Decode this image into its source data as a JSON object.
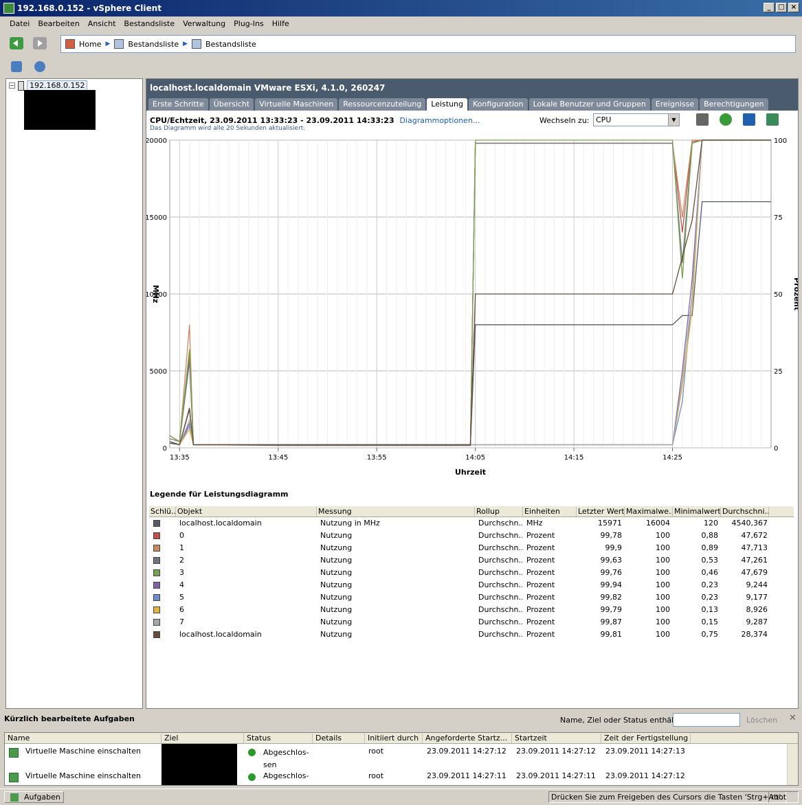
{
  "window": {
    "title": "192.168.0.152 - vSphere Client"
  },
  "menu": [
    "Datei",
    "Bearbeiten",
    "Ansicht",
    "Bestandsliste",
    "Verwaltung",
    "Plug-Ins",
    "Hilfe"
  ],
  "breadcrumb": {
    "home": "Home",
    "item1": "Bestandsliste",
    "item2": "Bestandsliste"
  },
  "tree": {
    "root_label": "192.168.0.152"
  },
  "host_header": "localhost.localdomain VMware ESXi, 4.1.0, 260247",
  "tabs": [
    "Erste Schritte",
    "Übersicht",
    "Virtuelle Maschinen",
    "Ressourcenzuteilung",
    "Leistung",
    "Konfiguration",
    "Lokale Benutzer und Gruppen",
    "Ereignisse",
    "Berechtigungen"
  ],
  "active_tab": "Leistung",
  "chart_header": {
    "title": "CPU/Echtzeit, 23.09.2011 13:33:23 - 23.09.2011 14:33:23",
    "options_link": "Diagrammoptionen...",
    "subtitle": "Das Diagramm wird alle 20 Sekunden aktualisiert.",
    "switch_label": "Wechseln zu:",
    "switch_value": "CPU"
  },
  "chart_data": {
    "type": "line",
    "xlabel": "Uhrzeit",
    "ylabel": "MHz",
    "y2label": "Prozent",
    "x_ticks": [
      "13:35",
      "13:45",
      "13:55",
      "14:05",
      "14:15",
      "14:25"
    ],
    "y_ticks": [
      "0",
      "5000",
      "10000",
      "15000",
      "20000"
    ],
    "y2_ticks": [
      "0",
      "25",
      "50",
      "75",
      "100"
    ],
    "ylim": [
      0,
      20000
    ],
    "y2lim": [
      0,
      100
    ],
    "x_range_minutes": [
      -1,
      60
    ],
    "series": [
      {
        "name": "localhost.localdomain",
        "unit": "MHz",
        "color": "#555b66",
        "points": [
          [
            -1,
            300
          ],
          [
            0,
            200
          ],
          [
            1,
            2500
          ],
          [
            1.4,
            200
          ],
          [
            10,
            150
          ],
          [
            20,
            150
          ],
          [
            29.5,
            150
          ],
          [
            30,
            8000
          ],
          [
            40,
            8000
          ],
          [
            50,
            8000
          ],
          [
            51,
            8600
          ],
          [
            52,
            8600
          ],
          [
            53,
            16000
          ],
          [
            60,
            16000
          ]
        ]
      },
      {
        "name": "0",
        "unit": "Prozent",
        "color": "#c0504d",
        "points": [
          [
            -1,
            4
          ],
          [
            0,
            2
          ],
          [
            1,
            30
          ],
          [
            1.4,
            1
          ],
          [
            10,
            1
          ],
          [
            20,
            1
          ],
          [
            29.5,
            1
          ],
          [
            30,
            99
          ],
          [
            40,
            99
          ],
          [
            50,
            99
          ],
          [
            51,
            70
          ],
          [
            52,
            99.5
          ],
          [
            53,
            100
          ],
          [
            60,
            100
          ]
        ]
      },
      {
        "name": "1",
        "unit": "Prozent",
        "color": "#c98a60",
        "points": [
          [
            -1,
            4
          ],
          [
            0,
            2
          ],
          [
            1,
            40
          ],
          [
            1.4,
            1
          ],
          [
            10,
            1
          ],
          [
            20,
            1
          ],
          [
            29.5,
            1
          ],
          [
            30,
            99
          ],
          [
            40,
            99
          ],
          [
            50,
            99
          ],
          [
            51,
            75
          ],
          [
            52,
            100
          ],
          [
            53,
            100
          ],
          [
            60,
            100
          ]
        ]
      },
      {
        "name": "2",
        "unit": "Prozent",
        "color": "#6f7480",
        "points": [
          [
            -1,
            3
          ],
          [
            0,
            2
          ],
          [
            1,
            28
          ],
          [
            1.4,
            1
          ],
          [
            10,
            1
          ],
          [
            20,
            1
          ],
          [
            29.5,
            1
          ],
          [
            30,
            99
          ],
          [
            40,
            99
          ],
          [
            50,
            99
          ],
          [
            51,
            60
          ],
          [
            52,
            99
          ],
          [
            53,
            100
          ],
          [
            60,
            100
          ]
        ]
      },
      {
        "name": "3",
        "unit": "Prozent",
        "color": "#77a24f",
        "points": [
          [
            -1,
            4
          ],
          [
            0,
            2
          ],
          [
            1,
            32
          ],
          [
            1.4,
            1
          ],
          [
            10,
            1
          ],
          [
            20,
            1
          ],
          [
            29.5,
            1
          ],
          [
            30,
            100
          ],
          [
            40,
            100
          ],
          [
            50,
            100
          ],
          [
            51,
            55
          ],
          [
            52,
            99
          ],
          [
            53,
            100
          ],
          [
            60,
            100
          ]
        ]
      },
      {
        "name": "4",
        "unit": "Prozent",
        "color": "#8064a2",
        "points": [
          [
            -1,
            2
          ],
          [
            0,
            1
          ],
          [
            1,
            8
          ],
          [
            1.4,
            1
          ],
          [
            10,
            1
          ],
          [
            20,
            1
          ],
          [
            29.5,
            1
          ],
          [
            30,
            1
          ],
          [
            40,
            1
          ],
          [
            50,
            1
          ],
          [
            51,
            25
          ],
          [
            52,
            55
          ],
          [
            53,
            100
          ],
          [
            60,
            100
          ]
        ]
      },
      {
        "name": "5",
        "unit": "Prozent",
        "color": "#6f8ec9",
        "points": [
          [
            -1,
            2
          ],
          [
            0,
            1
          ],
          [
            1,
            7
          ],
          [
            1.4,
            1
          ],
          [
            10,
            1
          ],
          [
            20,
            1
          ],
          [
            29.5,
            1
          ],
          [
            30,
            1
          ],
          [
            40,
            1
          ],
          [
            50,
            1
          ],
          [
            51,
            15
          ],
          [
            52,
            50
          ],
          [
            53,
            100
          ],
          [
            60,
            100
          ]
        ]
      },
      {
        "name": "6",
        "unit": "Prozent",
        "color": "#e3b448",
        "points": [
          [
            -1,
            2
          ],
          [
            0,
            1
          ],
          [
            1,
            6
          ],
          [
            1.4,
            1
          ],
          [
            10,
            1
          ],
          [
            20,
            1
          ],
          [
            29.5,
            1
          ],
          [
            30,
            1
          ],
          [
            40,
            1
          ],
          [
            50,
            1
          ],
          [
            51,
            20
          ],
          [
            52,
            45
          ],
          [
            53,
            100
          ],
          [
            60,
            100
          ]
        ]
      },
      {
        "name": "7",
        "unit": "Prozent",
        "color": "#a8a8a8",
        "points": [
          [
            -1,
            2
          ],
          [
            0,
            1
          ],
          [
            1,
            9
          ],
          [
            1.4,
            1
          ],
          [
            10,
            1
          ],
          [
            20,
            1
          ],
          [
            29.5,
            1
          ],
          [
            30,
            1
          ],
          [
            40,
            1
          ],
          [
            50,
            1
          ],
          [
            51,
            22
          ],
          [
            52,
            50
          ],
          [
            53,
            100
          ],
          [
            60,
            100
          ]
        ]
      },
      {
        "name": "localhost.localdomain",
        "unit": "Prozent",
        "color": "#6b4a3a",
        "points": [
          [
            -1,
            2
          ],
          [
            0,
            1
          ],
          [
            1,
            13
          ],
          [
            1.4,
            1
          ],
          [
            10,
            1
          ],
          [
            20,
            1
          ],
          [
            29.5,
            1
          ],
          [
            30,
            50
          ],
          [
            40,
            50
          ],
          [
            50,
            50
          ],
          [
            51,
            62
          ],
          [
            52,
            74
          ],
          [
            53,
            100
          ],
          [
            60,
            100
          ]
        ]
      }
    ]
  },
  "legend": {
    "title": "Legende für Leistungsdiagramm",
    "columns": [
      "Schlü...",
      "Objekt",
      "Messung",
      "Rollup",
      "Einheiten",
      "Letzter Wert",
      "Maximalwe...",
      "Minimalwert",
      "Durchschni..."
    ],
    "rows": [
      {
        "color": "#555b66",
        "object": "localhost.localdomain",
        "measure": "Nutzung in MHz",
        "rollup": "Durchschn...",
        "unit": "MHz",
        "last": "15971",
        "max": "16004",
        "min": "120",
        "avg": "4540,367"
      },
      {
        "color": "#c0504d",
        "object": "0",
        "measure": "Nutzung",
        "rollup": "Durchschn...",
        "unit": "Prozent",
        "last": "99,78",
        "max": "100",
        "min": "0,88",
        "avg": "47,672"
      },
      {
        "color": "#c98a60",
        "object": "1",
        "measure": "Nutzung",
        "rollup": "Durchschn...",
        "unit": "Prozent",
        "last": "99,9",
        "max": "100",
        "min": "0,89",
        "avg": "47,713"
      },
      {
        "color": "#6f7480",
        "object": "2",
        "measure": "Nutzung",
        "rollup": "Durchschn...",
        "unit": "Prozent",
        "last": "99,63",
        "max": "100",
        "min": "0,53",
        "avg": "47,261"
      },
      {
        "color": "#77a24f",
        "object": "3",
        "measure": "Nutzung",
        "rollup": "Durchschn...",
        "unit": "Prozent",
        "last": "99,76",
        "max": "100",
        "min": "0,46",
        "avg": "47,679"
      },
      {
        "color": "#8064a2",
        "object": "4",
        "measure": "Nutzung",
        "rollup": "Durchschn...",
        "unit": "Prozent",
        "last": "99,94",
        "max": "100",
        "min": "0,23",
        "avg": "9,244"
      },
      {
        "color": "#6f8ec9",
        "object": "5",
        "measure": "Nutzung",
        "rollup": "Durchschn...",
        "unit": "Prozent",
        "last": "99,82",
        "max": "100",
        "min": "0,23",
        "avg": "9,177"
      },
      {
        "color": "#e3b448",
        "object": "6",
        "measure": "Nutzung",
        "rollup": "Durchschn...",
        "unit": "Prozent",
        "last": "99,79",
        "max": "100",
        "min": "0,13",
        "avg": "8,926"
      },
      {
        "color": "#a8a8a8",
        "object": "7",
        "measure": "Nutzung",
        "rollup": "Durchschn...",
        "unit": "Prozent",
        "last": "99,87",
        "max": "100",
        "min": "0,15",
        "avg": "9,287"
      },
      {
        "color": "#6b4a3a",
        "object": "localhost.localdomain",
        "measure": "Nutzung",
        "rollup": "Durchschn...",
        "unit": "Prozent",
        "last": "99,81",
        "max": "100",
        "min": "0,75",
        "avg": "28,374"
      }
    ]
  },
  "tasks": {
    "title": "Kürzlich bearbeitete Aufgaben",
    "filter_label": "Name, Ziel oder Status enthält: ▾",
    "filter_value": "",
    "clear_label": "Löschen",
    "columns": [
      "Name",
      "Ziel",
      "Status",
      "Details",
      "Initiiert durch",
      "Angeforderte Startz...",
      "Startzeit",
      "Zeit der Fertigstellung"
    ],
    "rows": [
      {
        "name": "Virtuelle Maschine einschalten",
        "status_line1": "Abgeschlos-",
        "status_line2": "sen",
        "initiator": "root",
        "requested": "23.09.2011 14:27:12",
        "start": "23.09.2011 14:27:12",
        "done": "23.09.2011 14:27:13"
      },
      {
        "name": "Virtuelle Maschine einschalten",
        "status_line1": "Abgeschlos-",
        "status_line2": "",
        "initiator": "root",
        "requested": "23.09.2011 14:27:11",
        "start": "23.09.2011 14:27:11",
        "done": "23.09.2011 14:27:12"
      }
    ]
  },
  "statusbar": {
    "tasks_button": "Aufgaben",
    "message": "Drücken Sie zum Freigeben des Cursors die Tasten 'Strg+Alt'.",
    "user": "root"
  }
}
